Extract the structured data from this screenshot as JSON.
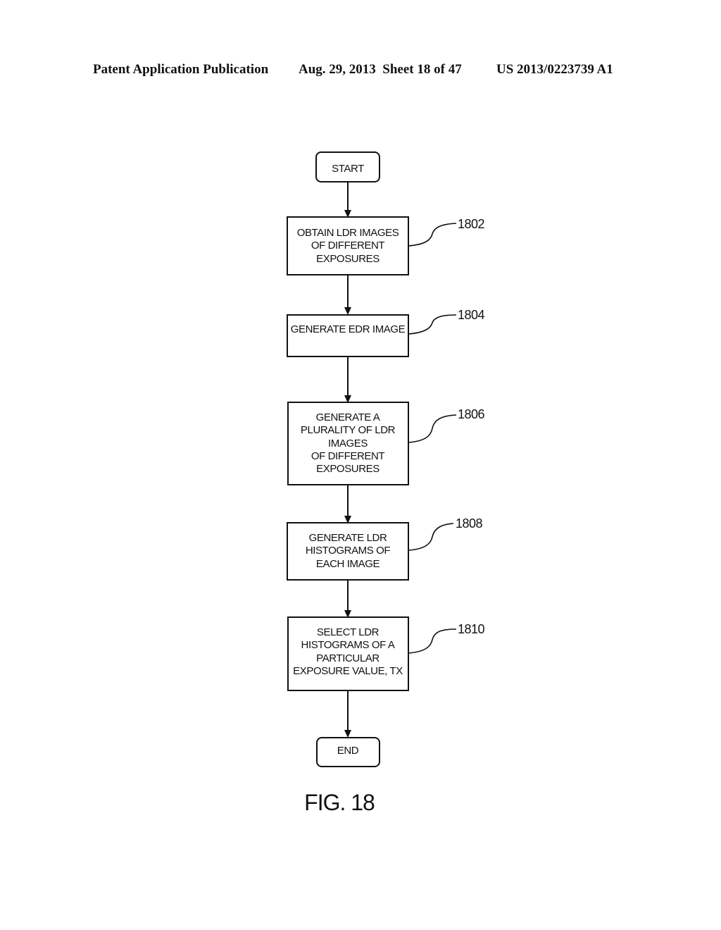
{
  "header": {
    "publication_type": "Patent Application Publication",
    "date_sheet": "Aug. 29, 2013  Sheet 18 of 47",
    "patent_number": "US 2013/0223739 A1"
  },
  "flowchart": {
    "start": "START",
    "steps": [
      {
        "ref": "1802",
        "lines": [
          "OBTAIN LDR IMAGES",
          "OF DIFFERENT",
          "EXPOSURES"
        ]
      },
      {
        "ref": "1804",
        "lines": [
          "GENERATE EDR IMAGE"
        ]
      },
      {
        "ref": "1806",
        "lines": [
          "GENERATE A",
          "PLURALITY OF LDR",
          "IMAGES",
          "OF DIFFERENT",
          "EXPOSURES"
        ]
      },
      {
        "ref": "1808",
        "lines": [
          "GENERATE LDR",
          "HISTOGRAMS OF",
          "EACH IMAGE"
        ]
      },
      {
        "ref": "1810",
        "lines": [
          "SELECT LDR",
          "HISTOGRAMS OF A",
          "PARTICULAR",
          "EXPOSURE VALUE, TX"
        ]
      }
    ],
    "end": "END"
  },
  "figure_label": "FIG. 18"
}
